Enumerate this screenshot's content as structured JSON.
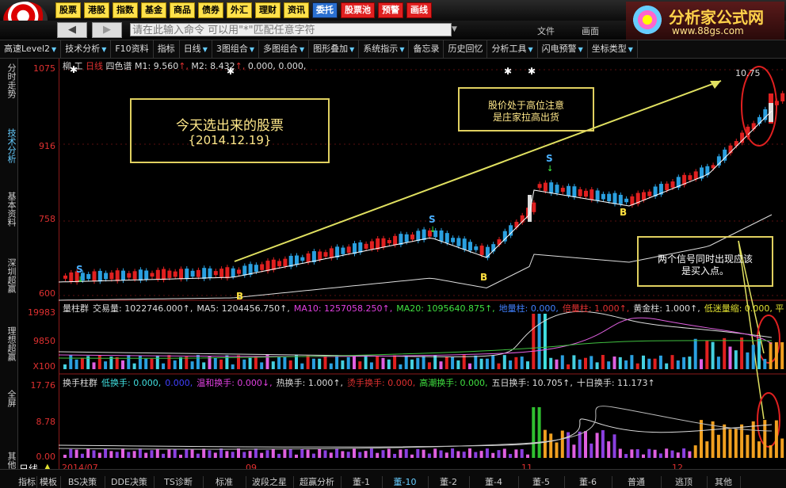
{
  "top_menu": [
    {
      "label": "股票",
      "style": "yellow"
    },
    {
      "label": "港股",
      "style": "yellow"
    },
    {
      "label": "指数",
      "style": "yellow"
    },
    {
      "label": "基金",
      "style": "yellow"
    },
    {
      "label": "商品",
      "style": "yellow"
    },
    {
      "label": "债券",
      "style": "yellow"
    },
    {
      "label": "外汇",
      "style": "yellow"
    },
    {
      "label": "理财",
      "style": "yellow"
    },
    {
      "label": "资讯",
      "style": "yellow"
    },
    {
      "label": "委托",
      "style": "blue"
    },
    {
      "label": "股票池",
      "style": "red"
    },
    {
      "label": "预警",
      "style": "red"
    },
    {
      "label": "画线",
      "style": "red"
    }
  ],
  "command": {
    "placeholder": "请在此输入命令    可以用\"*\"匹配任意字符"
  },
  "top_right_menu": [
    "文件",
    "画面"
  ],
  "brand": {
    "title": "分析家公式网",
    "url": "www.88gs.com"
  },
  "toolbar": [
    "高速Level2",
    "技术分析",
    "F10资料",
    "指标",
    "日线",
    "3图组合",
    "多图组合",
    "图形叠加",
    "系统指示",
    "备忘录",
    "历史回忆",
    "分析工具",
    "闪电预警",
    "坐标类型"
  ],
  "toolbar_dropdowns": [
    true,
    true,
    false,
    false,
    true,
    true,
    true,
    true,
    true,
    false,
    false,
    true,
    true,
    true
  ],
  "left_nav": [
    {
      "label": "分时走势",
      "active": false
    },
    {
      "label": "技术分析",
      "active": true
    },
    {
      "label": "基本资料",
      "active": false
    },
    {
      "label": "深圳超赢",
      "active": false
    },
    {
      "label": "理想超赢",
      "active": false
    },
    {
      "label": "全屏",
      "active": false
    },
    {
      "label": "其他",
      "active": false
    }
  ],
  "axis": {
    "price_labels": [
      "1075",
      "916",
      "758",
      "600"
    ],
    "vol_labels": [
      "19983",
      "9850",
      "X100"
    ],
    "turn_labels": [
      "17.76",
      "8.78",
      "0.00"
    ]
  },
  "price_legend": {
    "name": "柳  工",
    "period": "日线",
    "indicator": "四色谱",
    "m1_label": "M1:",
    "m1": "9.560",
    "m2_label": "M2:",
    "m2": "8.432",
    "rest": "0.000, 0.000,"
  },
  "vol_legend": [
    {
      "text": "量柱群",
      "color": "#dddddd"
    },
    {
      "text": "交易量: 1022746.000↑,",
      "color": "#dddddd"
    },
    {
      "text": "MA5: 1204456.750↑,",
      "color": "#dddddd"
    },
    {
      "text": "MA10: 1257058.250↑,",
      "color": "#e040e0"
    },
    {
      "text": "MA20: 1095640.875↑,",
      "color": "#40e040"
    },
    {
      "text": "地量柱: 0.000,",
      "color": "#4080ff"
    },
    {
      "text": "倍量柱: 1.000↑,",
      "color": "#e03030"
    },
    {
      "text": "黄金柱: 1.000↑,",
      "color": "#dddddd"
    },
    {
      "text": "低迷量缩: 0.000, 平",
      "color": "#e0e030"
    }
  ],
  "turn_legend": [
    {
      "text": "换手柱群",
      "color": "#dddddd"
    },
    {
      "text": "低换手: 0.000,",
      "color": "#40e0e0"
    },
    {
      "text": "0.000,",
      "color": "#4040ff"
    },
    {
      "text": "温和换手: 0.000↓,",
      "color": "#e040e0"
    },
    {
      "text": "热换手: 1.000↑,",
      "color": "#dddddd"
    },
    {
      "text": "烫手换手: 0.000,",
      "color": "#e03030"
    },
    {
      "text": "高潮换手: 0.000,",
      "color": "#40e040"
    },
    {
      "text": "五日换手: 10.705↑,",
      "color": "#dddddd"
    },
    {
      "text": "十日换手: 11.173↑",
      "color": "#dddddd"
    }
  ],
  "annotations": {
    "today_line1": "今天选出来的股票",
    "today_line2": "{2014.12.19}",
    "high_line1": "股价处于高位注意",
    "high_line2": "是庄家拉高出货",
    "buy_line1": "两个信号同时出现应该",
    "buy_line2": "是买入点。",
    "price_tag": "10.75"
  },
  "signals": {
    "s": "S",
    "b": "B"
  },
  "date_labels": [
    "2014/07",
    "09",
    "11",
    "12"
  ],
  "period_label": "日线",
  "bottom_tabs": [
    {
      "label": "指标",
      "on": false
    },
    {
      "label": "模板",
      "on": false
    },
    {
      "label": "BS决策",
      "on": false
    },
    {
      "label": "DDE决策",
      "on": false
    },
    {
      "label": "TS诊断",
      "on": false
    },
    {
      "label": "标准",
      "on": false
    },
    {
      "label": "波段之星",
      "on": false
    },
    {
      "label": "超赢分析",
      "on": false
    },
    {
      "label": "董-1",
      "on": false
    },
    {
      "label": "董-10",
      "on": true
    },
    {
      "label": "董-2",
      "on": false
    },
    {
      "label": "董-4",
      "on": false
    },
    {
      "label": "董-5",
      "on": false
    },
    {
      "label": "董-6",
      "on": false
    },
    {
      "label": "普通",
      "on": false
    },
    {
      "label": "逃顶",
      "on": false
    },
    {
      "label": "其他",
      "on": false
    }
  ],
  "colors": {
    "up": "#e02020",
    "down": "#2aa0e0",
    "accent": "#e0d060",
    "axis": "#e03030"
  }
}
